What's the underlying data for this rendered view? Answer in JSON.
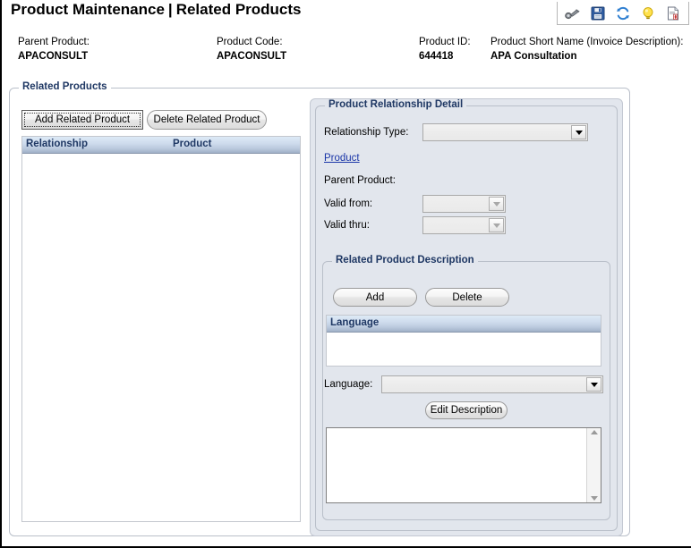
{
  "window": {
    "title_main": "Product Maintenance",
    "title_separator": "|",
    "title_sub": "Related Products"
  },
  "toolbar": {
    "icons": [
      {
        "name": "binoculars-icon",
        "label": "Search"
      },
      {
        "name": "save-icon",
        "label": "Save"
      },
      {
        "name": "refresh-icon",
        "label": "Refresh"
      },
      {
        "name": "lightbulb-icon",
        "label": "Hint"
      },
      {
        "name": "report-icon",
        "label": "Report"
      }
    ]
  },
  "header": {
    "parent_product_label": "Parent Product:",
    "parent_product_value": "APACONSULT",
    "product_code_label": "Product Code:",
    "product_code_value": "APACONSULT",
    "product_id_label": "Product ID:",
    "product_id_value": "644418",
    "short_name_label": "Product Short Name (Invoice Description):",
    "short_name_value": "APA Consultation"
  },
  "related_products": {
    "legend": "Related Products",
    "add_button": "Add Related Product",
    "delete_button": "Delete Related Product",
    "columns": [
      "Relationship",
      "Product"
    ],
    "rows": []
  },
  "relationship_detail": {
    "legend": "Product Relationship Detail",
    "relationship_type_label": "Relationship Type:",
    "relationship_type_value": "",
    "product_link": "Product",
    "parent_product_label": "Parent Product:",
    "parent_product_value": "",
    "valid_from_label": "Valid from:",
    "valid_from_value": "",
    "valid_thru_label": "Valid thru:",
    "valid_thru_value": ""
  },
  "description": {
    "legend": "Related Product Description",
    "add_button": "Add",
    "delete_button": "Delete",
    "columns": [
      "Language"
    ],
    "rows": [],
    "language_label": "Language:",
    "language_value": "",
    "edit_button": "Edit Description",
    "text_value": ""
  }
}
